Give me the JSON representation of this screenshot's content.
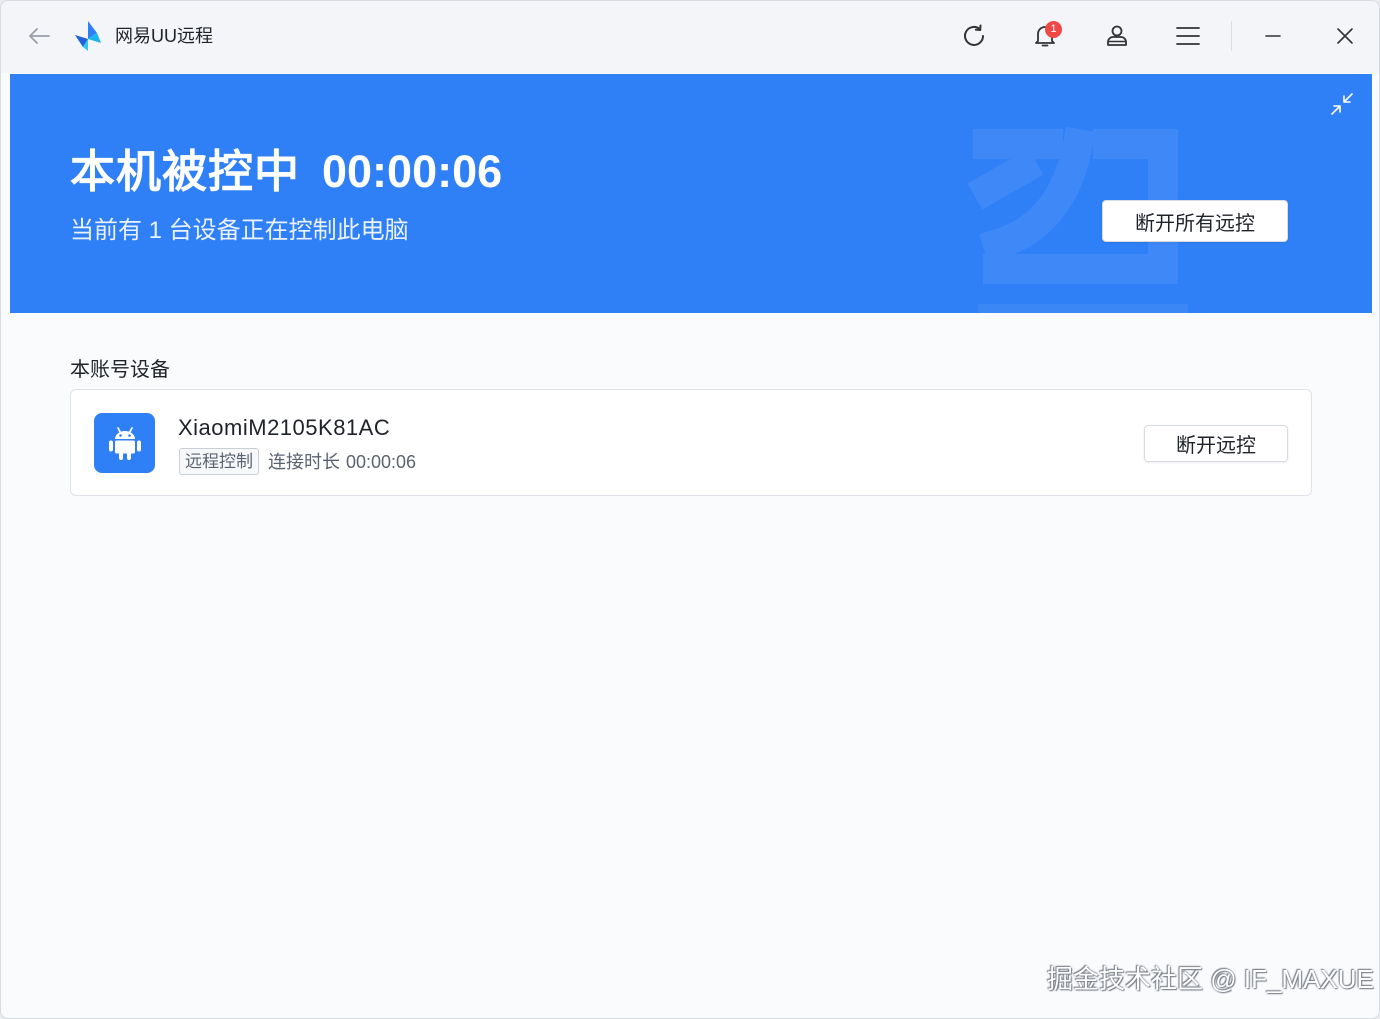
{
  "app": {
    "title": "网易UU远程",
    "notification_count": "1"
  },
  "icons": {
    "back": "arrow-left-icon",
    "logo": "uu-logo",
    "refresh": "refresh-icon",
    "bell": "bell-icon",
    "user": "user-icon",
    "menu": "menu-icon",
    "minimize": "minimize-icon",
    "close": "close-icon",
    "collapse": "collapse-icon",
    "device": "android-icon"
  },
  "banner": {
    "status_title": "本机被控中",
    "timer": "00:00:06",
    "subtitle": "当前有 1 台设备正在控制此电脑",
    "disconnect_all_label": "断开所有远控"
  },
  "devices_section": {
    "title": "本账号设备",
    "devices": [
      {
        "name": "XiaomiM2105K81AC",
        "tag": "远程控制",
        "duration_label": "连接时长",
        "duration": "00:00:06",
        "disconnect_label": "断开远控"
      }
    ]
  },
  "watermark": "掘金技术社区 @ IF_MAXUE",
  "colors": {
    "accent": "#2f7ff6",
    "badge": "#f04747",
    "background": "#fafbfd",
    "titlebar": "#f3f5f8"
  }
}
